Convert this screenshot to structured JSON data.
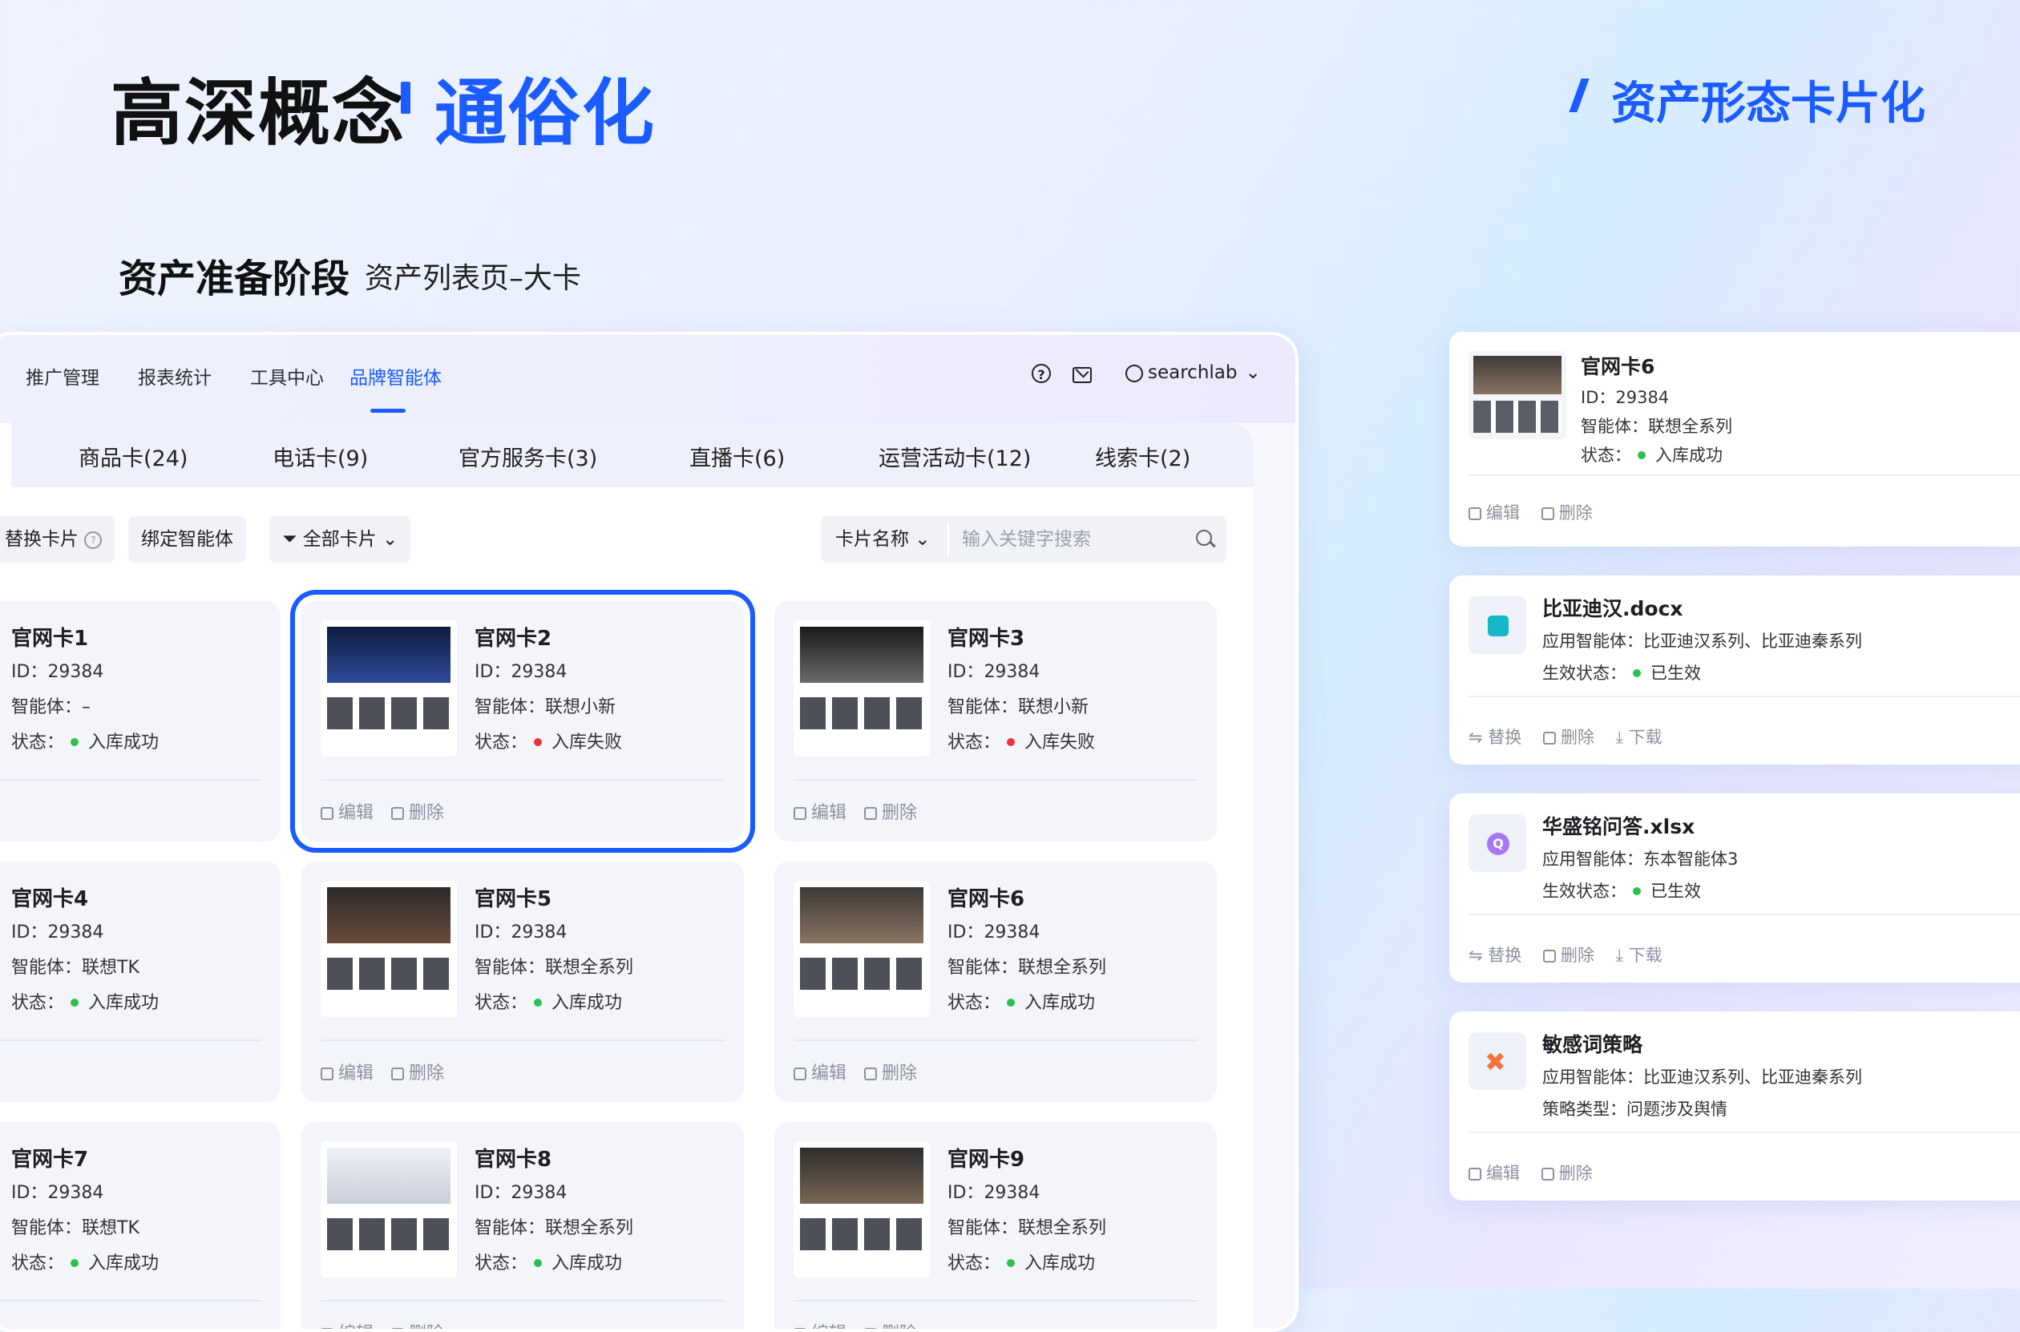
{
  "header": {
    "title_black": "高深概念",
    "title_blue": "通俗化",
    "right_title": "资产形态卡片化",
    "section": "资产准备阶段",
    "section_sub": "资产列表页–大卡"
  },
  "nav": {
    "items": [
      "推广管理",
      "报表统计",
      "工具中心",
      "品牌智能体"
    ],
    "user": "searchlab"
  },
  "tabs": [
    "商品卡(24)",
    "电话卡(9)",
    "官方服务卡(3)",
    "直播卡(6)",
    "运营活动卡(12)",
    "线索卡(2)"
  ],
  "toolbar": {
    "replace": "替换卡片",
    "bind": "绑定智能体",
    "filter": "全部卡片",
    "search_field": "卡片名称",
    "search_placeholder": "输入关键字搜索"
  },
  "labels": {
    "id": "ID：",
    "agent": "智能体：",
    "status": "状态：",
    "edit": "编辑",
    "delete": "删除"
  },
  "cards": [
    {
      "title": "官网卡1",
      "id": "29384",
      "agent": "–",
      "status": "入库成功",
      "ok": true
    },
    {
      "title": "官网卡2",
      "id": "29384",
      "agent": "联想小新",
      "status": "入库失败",
      "ok": false
    },
    {
      "title": "官网卡3",
      "id": "29384",
      "agent": "联想小新",
      "status": "入库失败",
      "ok": false
    },
    {
      "title": "官网卡4",
      "id": "29384",
      "agent": "联想TK",
      "status": "入库成功",
      "ok": true
    },
    {
      "title": "官网卡5",
      "id": "29384",
      "agent": "联想全系列",
      "status": "入库成功",
      "ok": true
    },
    {
      "title": "官网卡6",
      "id": "29384",
      "agent": "联想全系列",
      "status": "入库成功",
      "ok": true
    },
    {
      "title": "官网卡7",
      "id": "29384",
      "agent": "联想TK",
      "status": "入库成功",
      "ok": true
    },
    {
      "title": "官网卡8",
      "id": "29384",
      "agent": "联想全系列",
      "status": "入库成功",
      "ok": true
    },
    {
      "title": "官网卡9",
      "id": "29384",
      "agent": "联想全系列",
      "status": "入库成功",
      "ok": true
    }
  ],
  "right": {
    "card1": {
      "title": "官网卡6",
      "id": "ID：29384",
      "agent": "智能体：联想全系列",
      "status_label": "状态：",
      "status": "入库成功",
      "edit": "编辑",
      "delete": "删除"
    },
    "card2": {
      "title": "比亚迪汉.docx",
      "line1": "应用智能体：比亚迪汉系列、比亚迪秦系列",
      "status_label": "生效状态：",
      "status": "已生效",
      "replace": "替换",
      "delete": "删除",
      "download": "下载"
    },
    "card3": {
      "title": "华盛铭问答.xlsx",
      "line1": "应用智能体：东本智能体3",
      "status_label": "生效状态：",
      "status": "已生效",
      "replace": "替换",
      "delete": "删除",
      "download": "下载"
    },
    "card4": {
      "title": "敏感词策略",
      "line1": "应用智能体：比亚迪汉系列、比亚迪秦系列",
      "line2": "策略类型：问题涉及舆情",
      "edit": "编辑",
      "delete": "删除"
    }
  },
  "colors": {
    "accent": "#1a5cff",
    "success": "#2bc24b",
    "fail": "#e8343a"
  }
}
